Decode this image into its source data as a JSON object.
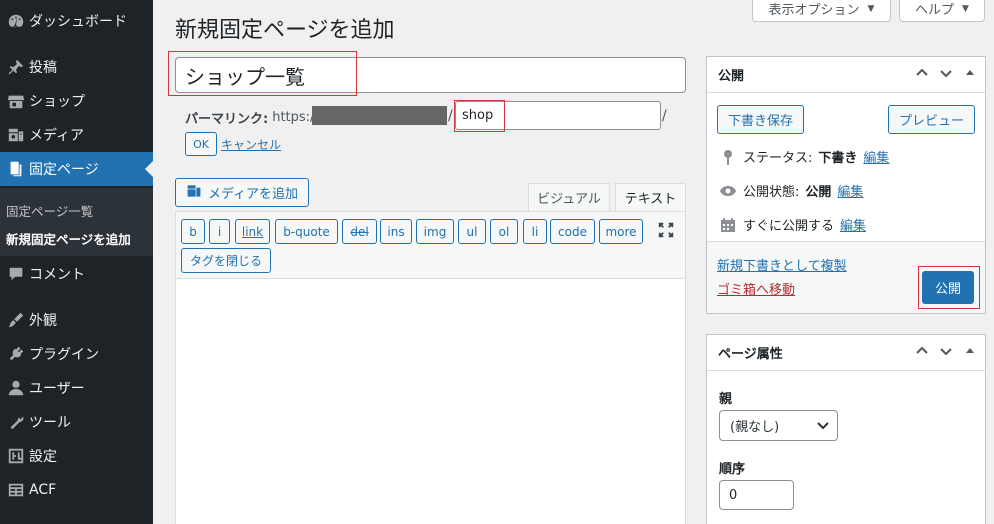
{
  "sidebar": {
    "items": [
      {
        "label": "ダッシュボード",
        "icon": "dashboard-icon"
      },
      {
        "label": "投稿",
        "icon": "pin-icon"
      },
      {
        "label": "ショップ",
        "icon": "store-icon"
      },
      {
        "label": "メディア",
        "icon": "media-icon"
      },
      {
        "label": "固定ページ",
        "icon": "page-icon"
      },
      {
        "label": "コメント",
        "icon": "comment-icon"
      },
      {
        "label": "外観",
        "icon": "brush-icon"
      },
      {
        "label": "プラグイン",
        "icon": "plugin-icon"
      },
      {
        "label": "ユーザー",
        "icon": "user-icon"
      },
      {
        "label": "ツール",
        "icon": "wrench-icon"
      },
      {
        "label": "設定",
        "icon": "settings-icon"
      },
      {
        "label": "ACF",
        "icon": "acf-icon"
      }
    ],
    "submenu": [
      {
        "label": "固定ページ一覧"
      },
      {
        "label": "新規固定ページを追加"
      }
    ]
  },
  "top": {
    "screen_options": "表示オプション",
    "help": "ヘルプ"
  },
  "page_title": "新規固定ページを追加",
  "editor": {
    "title_value": "ショップ一覧",
    "permalink_label": "パーマリンク:",
    "permalink_base": "https://",
    "slug_value": "shop",
    "ok_label": "OK",
    "cancel_label": "キャンセル",
    "add_media_label": "メディアを追加",
    "tab_visual": "ビジュアル",
    "tab_text": "テキスト",
    "quicktags": [
      "b",
      "i",
      "link",
      "b-quote",
      "del",
      "ins",
      "img",
      "ul",
      "ol",
      "li",
      "code",
      "more",
      "タグを閉じる"
    ]
  },
  "publish_box": {
    "title": "公開",
    "save_draft": "下書き保存",
    "preview": "プレビュー",
    "status_label": "ステータス:",
    "status_value": "下書き",
    "visibility_label": "公開状態:",
    "visibility_value": "公開",
    "schedule_label": "すぐに公開する",
    "edit_label": "編集",
    "duplicate_link": "新規下書きとして複製",
    "trash_link": "ゴミ箱へ移動",
    "publish_button": "公開"
  },
  "page_attributes": {
    "title": "ページ属性",
    "parent_label": "親",
    "parent_value": "(親なし)",
    "order_label": "順序",
    "order_value": "0"
  },
  "colors": {
    "admin_bar": "#1d2327",
    "accent": "#2271b1",
    "highlight_box": "#d63638"
  }
}
